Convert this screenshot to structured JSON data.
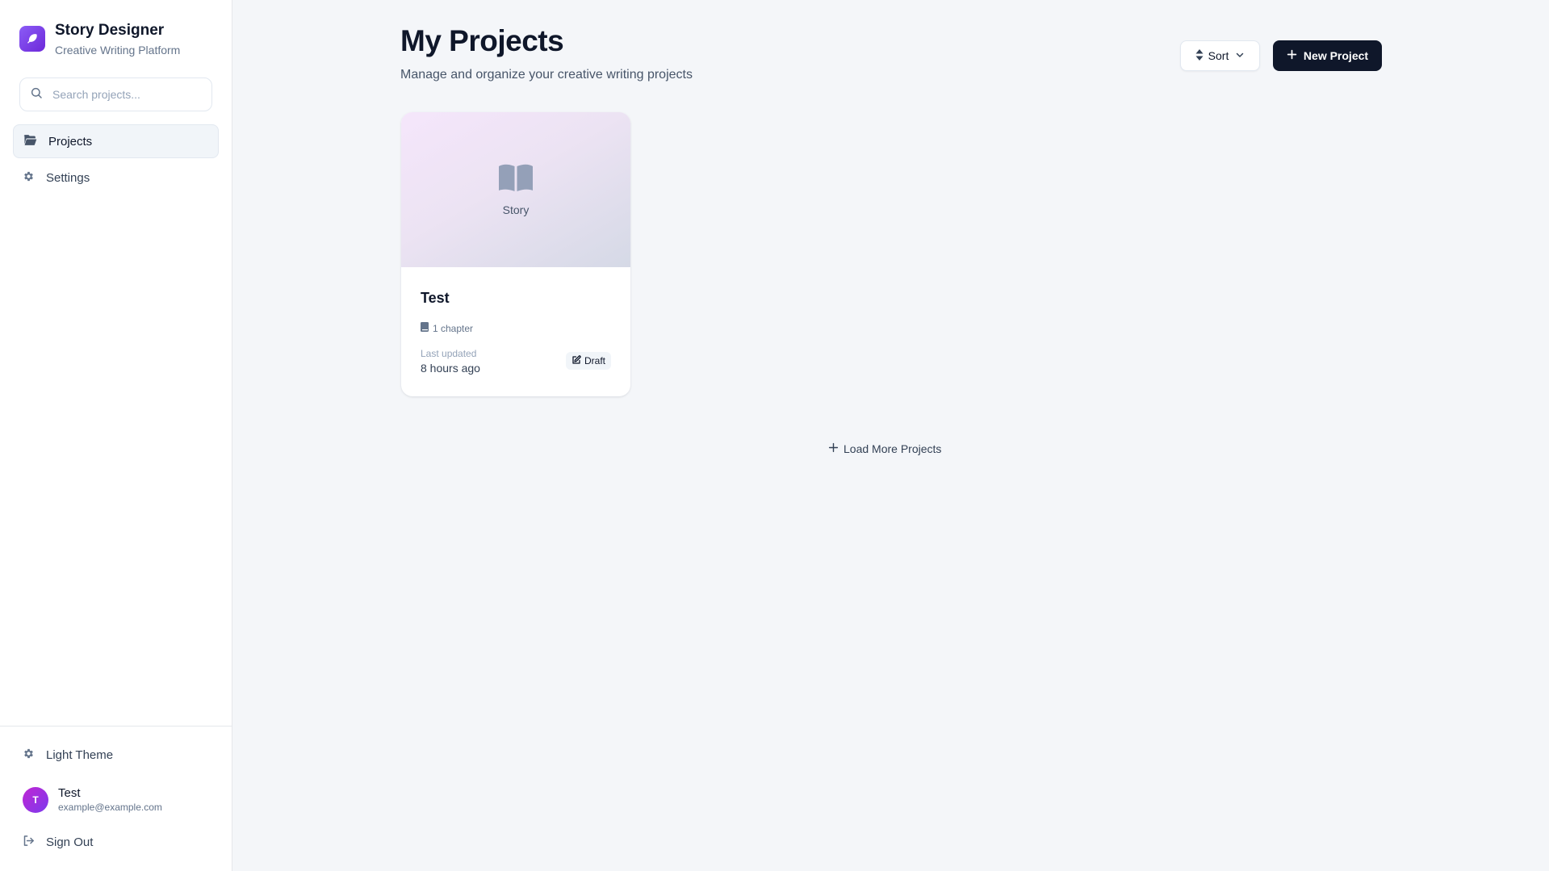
{
  "brand": {
    "title": "Story Designer",
    "subtitle": "Creative Writing Platform",
    "logo_icon": "feather-icon",
    "accent": "#7c3aed"
  },
  "search": {
    "placeholder": "Search projects...",
    "value": ""
  },
  "nav": {
    "items": [
      {
        "label": "Projects",
        "icon": "folder-open-icon",
        "active": true
      },
      {
        "label": "Settings",
        "icon": "gear-icon",
        "active": false
      }
    ]
  },
  "footer": {
    "theme_label": "Light Theme",
    "user": {
      "initial": "T",
      "name": "Test",
      "email": "example@example.com"
    },
    "signout_label": "Sign Out"
  },
  "header": {
    "title": "My Projects",
    "subtitle": "Manage and organize your creative writing projects",
    "sort_label": "Sort",
    "new_label": "New Project"
  },
  "projects": [
    {
      "cover_label": "Story",
      "title": "Test",
      "chapters": "1 chapter",
      "updated_label": "Last updated",
      "updated_value": "8 hours ago",
      "status": "Draft"
    }
  ],
  "load_more_label": "Load More Projects",
  "colors": {
    "primary_button": "#0f172a",
    "background": "#f4f6f9"
  }
}
